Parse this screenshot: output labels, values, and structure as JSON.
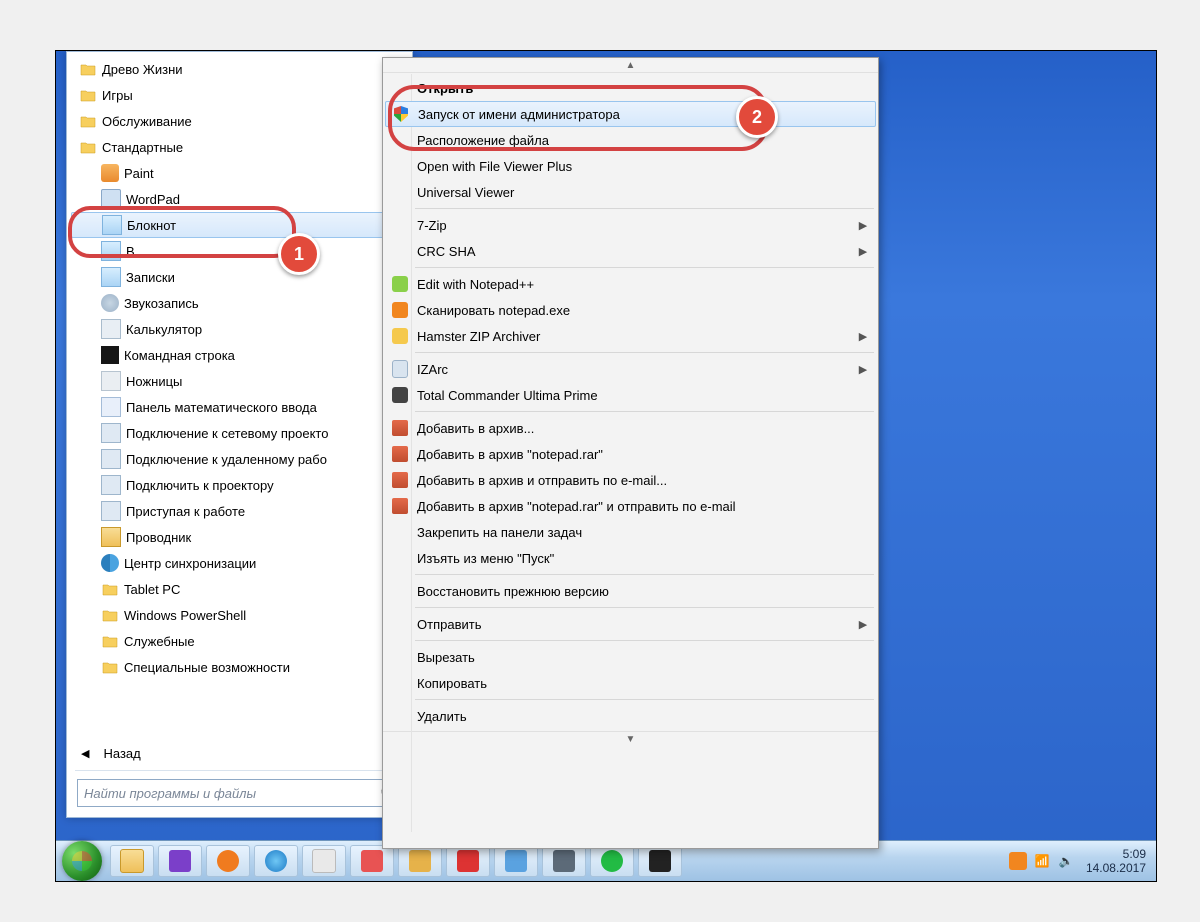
{
  "start_menu": {
    "folders_top": [
      "Древо Жизни",
      "Игры",
      "Обслуживание",
      "Стандартные"
    ],
    "accessories": [
      {
        "icon": "paint",
        "label": "Paint"
      },
      {
        "icon": "word",
        "label": "WordPad"
      },
      {
        "icon": "note",
        "label": "Блокнот",
        "selected": true
      },
      {
        "icon": "run",
        "label": "В"
      },
      {
        "icon": "note",
        "label": "Записки"
      },
      {
        "icon": "mic",
        "label": "Звукозапись"
      },
      {
        "icon": "calc",
        "label": "Калькулятор"
      },
      {
        "icon": "cmd",
        "label": "Командная строка"
      },
      {
        "icon": "sci",
        "label": "Ножницы"
      },
      {
        "icon": "pen",
        "label": "Панель математического ввода"
      },
      {
        "icon": "proj",
        "label": "Подключение к сетевому проекто"
      },
      {
        "icon": "proj",
        "label": "Подключение к удаленному рабо"
      },
      {
        "icon": "proj",
        "label": "Подключить к проектору"
      },
      {
        "icon": "flag",
        "label": "Приступая к работе"
      },
      {
        "icon": "exp",
        "label": "Проводник"
      },
      {
        "icon": "sync",
        "label": "Центр синхронизации"
      }
    ],
    "sub_folders": [
      "Tablet PC",
      "Windows PowerShell",
      "Служебные",
      "Специальные возможности"
    ],
    "back_label": "Назад",
    "search_placeholder": "Найти программы и файлы"
  },
  "context_menu": {
    "items": [
      {
        "label": "Открыть",
        "bold": true
      },
      {
        "label": "Запуск от имени администратора",
        "icon": "shield",
        "highlight": true
      },
      {
        "label": "Расположение файла"
      },
      {
        "label": "Open with File Viewer Plus"
      },
      {
        "label": "Universal Viewer"
      },
      {
        "sep": true
      },
      {
        "label": "7-Zip",
        "sub": true
      },
      {
        "label": "CRC SHA",
        "sub": true
      },
      {
        "sep": true
      },
      {
        "label": "Edit with Notepad++",
        "icon": "np"
      },
      {
        "label": "Сканировать notepad.exe",
        "icon": "av"
      },
      {
        "label": "Hamster ZIP Archiver",
        "icon": "hz",
        "sub": true
      },
      {
        "sep": true
      },
      {
        "label": "IZArc",
        "icon": "iz",
        "sub": true
      },
      {
        "label": "Total Commander Ultima Prime",
        "icon": "tc"
      },
      {
        "sep": true
      },
      {
        "label": "Добавить в архив...",
        "icon": "wr"
      },
      {
        "label": "Добавить в архив \"notepad.rar\"",
        "icon": "wr"
      },
      {
        "label": "Добавить в архив и отправить по e-mail...",
        "icon": "wr"
      },
      {
        "label": "Добавить в архив \"notepad.rar\" и отправить по e-mail",
        "icon": "wr"
      },
      {
        "label": "Закрепить на панели задач"
      },
      {
        "label": "Изъять из меню \"Пуск\""
      },
      {
        "sep": true
      },
      {
        "label": "Восстановить прежнюю версию"
      },
      {
        "sep": true
      },
      {
        "label": "Отправить",
        "sub": true
      },
      {
        "sep": true
      },
      {
        "label": "Вырезать"
      },
      {
        "label": "Копировать"
      },
      {
        "sep": true
      },
      {
        "label": "Удалить"
      }
    ]
  },
  "callouts": {
    "one": "1",
    "two": "2"
  },
  "taskbar": {
    "time": "5:09",
    "date": "14.08.2017"
  }
}
